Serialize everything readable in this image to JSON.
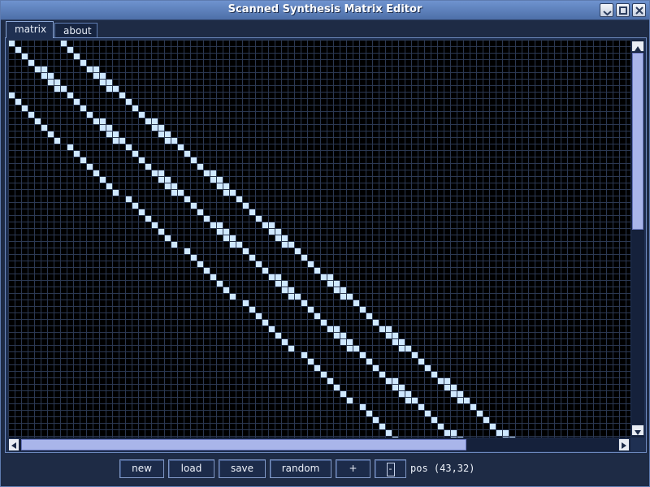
{
  "window": {
    "title": "Scanned Synthesis Matrix Editor",
    "controls": [
      "minimize-icon",
      "maximize-icon",
      "close-icon"
    ]
  },
  "tabs": [
    {
      "label": "matrix",
      "active": true
    },
    {
      "label": "about",
      "active": false
    }
  ],
  "matrix": {
    "background": "#000000",
    "grid_color": "#2b3852",
    "cell_color": "#cfe8ff",
    "note": "diagonal band pattern"
  },
  "toolbar": {
    "new_label": "new",
    "load_label": "load",
    "save_label": "save",
    "random_label": "random",
    "plus_label": "+",
    "minus_label": "-",
    "position_text": "pos (43,32)"
  },
  "colors": {
    "accent": "#6f93cf",
    "scroll_thumb": "#a9b5ea",
    "panel": "#1f3052"
  }
}
